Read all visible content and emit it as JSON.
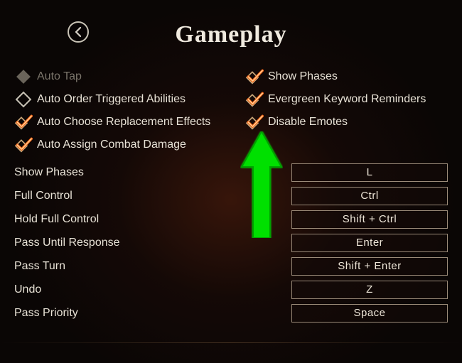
{
  "title": "Gameplay",
  "options_left": [
    {
      "label": "Auto Tap",
      "state": "disabled"
    },
    {
      "label": "Auto Order Triggered Abilities",
      "state": "unchecked"
    },
    {
      "label": "Auto Choose Replacement Effects",
      "state": "checked"
    },
    {
      "label": "Auto Assign Combat Damage",
      "state": "checked"
    }
  ],
  "options_right": [
    {
      "label": "Show Phases",
      "state": "checked"
    },
    {
      "label": "Evergreen Keyword Reminders",
      "state": "checked"
    },
    {
      "label": "Disable Emotes",
      "state": "checked"
    }
  ],
  "bindings": [
    {
      "label": "Show Phases",
      "key": "L"
    },
    {
      "label": "Full Control",
      "key": "Ctrl"
    },
    {
      "label": "Hold Full Control",
      "key": "Shift + Ctrl"
    },
    {
      "label": "Pass Until Response",
      "key": "Enter"
    },
    {
      "label": "Pass Turn",
      "key": "Shift + Enter"
    },
    {
      "label": "Undo",
      "key": "Z"
    },
    {
      "label": "Pass Priority",
      "key": "Space"
    }
  ]
}
